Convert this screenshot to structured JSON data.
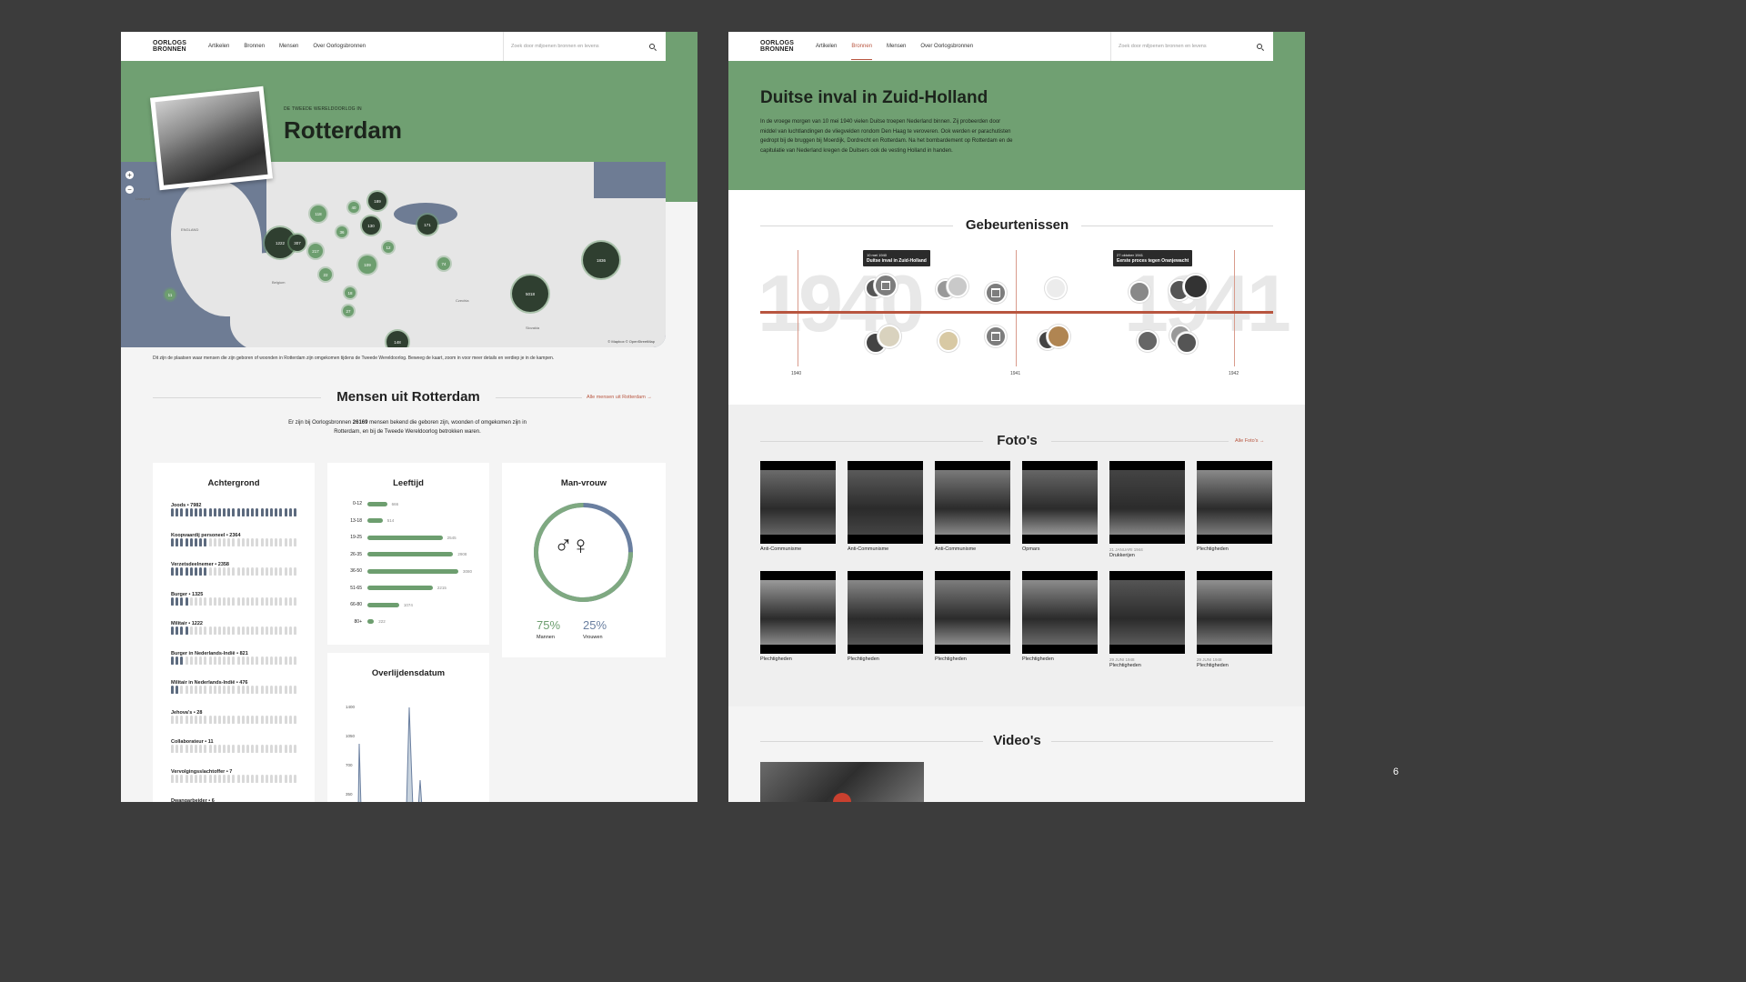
{
  "page_number": "6",
  "left": {
    "logo": [
      "OORLOGS",
      "BRONNEN"
    ],
    "nav": [
      "Artikelen",
      "Bronnen",
      "Mensen",
      "Over Oorlogsbronnen"
    ],
    "search_placeholder": "Zoek door miljoenen bronnen en levens",
    "hero": {
      "kicker": "DE TWEEDE WERELDOORLOG IN",
      "title": "Rotterdam"
    },
    "map": {
      "labels": [
        "ENGLAND",
        "Belgium",
        "Czechia",
        "Slovakia",
        "Liverpool"
      ],
      "clusters": [
        "1222",
        "307",
        "217",
        "118",
        "189",
        "130",
        "171",
        "1836",
        "5018",
        "109",
        "148",
        "74",
        "22",
        "40",
        "12",
        "18",
        "36",
        "27",
        "11"
      ],
      "attribution": "© Mapbox © OpenStreetMap",
      "caption": "Dit zijn de plaatsen waar mensen die zijn geboren of woonden in Rotterdam zijn omgekomen tijdens de Tweede Wereldoorlog. Beweeg de kaart, zoom in voor meer details en verdiep je in de kampen."
    },
    "people_section": {
      "title": "Mensen uit Rotterdam",
      "link": "Alle mensen uit Rotterdam",
      "intro_pre": "Er zijn bij Oorlogsbronnen ",
      "intro_count": "26169",
      "intro_post": " mensen bekend die geboren zijn, woonden of omgekomen zijn in Rotterdam, en bij de Tweede Wereldoorlog betrokken waren."
    },
    "background": {
      "title": "Achtergrond",
      "rows": [
        {
          "label": "Joods • 7982",
          "filled": 27
        },
        {
          "label": "Koopvaardij personeel • 2364",
          "filled": 8
        },
        {
          "label": "Verzetsdeelnemer • 2358",
          "filled": 8
        },
        {
          "label": "Burger • 1325",
          "filled": 4
        },
        {
          "label": "Militair • 1222",
          "filled": 4
        },
        {
          "label": "Burger in Nederlands-Indië • 821",
          "filled": 3
        },
        {
          "label": "Militair in Nederlands-Indië • 476",
          "filled": 2
        },
        {
          "label": "Jehova's • 28",
          "filled": 0
        },
        {
          "label": "Collaborateur • 11",
          "filled": 0
        },
        {
          "label": "Vervolgingsslachtoffer • 7",
          "filled": 0
        },
        {
          "label": "Dwangarbeider • 6",
          "filled": 0
        }
      ]
    },
    "age": {
      "title": "Leeftijd",
      "rows": [
        {
          "range": "0-12",
          "value": 666
        },
        {
          "range": "13-18",
          "value": 514
        },
        {
          "range": "19-25",
          "value": 2545
        },
        {
          "range": "26-35",
          "value": 2908
        },
        {
          "range": "36-50",
          "value": 3080
        },
        {
          "range": "51-65",
          "value": 2215
        },
        {
          "range": "66-80",
          "value": 1074
        },
        {
          "range": "80+",
          "value": 222
        }
      ]
    },
    "gender": {
      "title": "Man-vrouw",
      "symbol": "♂♀",
      "men_pct": "75%",
      "women_pct": "25%",
      "men_label": "Mannen",
      "women_label": "Vrouwen",
      "men_fraction": 0.75
    },
    "death_date": {
      "title": "Overlijdensdatum",
      "ticks": [
        "1400",
        "1050",
        "700",
        "350"
      ]
    }
  },
  "right": {
    "logo": [
      "OORLOGS",
      "BRONNEN"
    ],
    "nav": [
      "Artikelen",
      "Bronnen",
      "Mensen",
      "Over Oorlogsbronnen"
    ],
    "nav_active": 1,
    "search_placeholder": "Zoek door miljoenen bronnen en levens",
    "hero": {
      "title": "Duitse inval in Zuid-Holland",
      "intro": "In de vroege morgen van 10 mei 1940 vielen Duitse troepen Nederland binnen. Zij probeerden door middel van luchtlandingen de vliegvelden rondom Den Haag te veroveren. Ook werden er parachutisten gedropt bij de bruggen bij Moerdijk, Dordrecht en Rotterdam. Na het bombardement op Rotterdam en de capitulatie van Nederland kregen de Duitsers ook de vesting Holland in handen."
    },
    "events": {
      "title": "Gebeurtenissen",
      "big_years": [
        "1940",
        "1941"
      ],
      "tick_labels": [
        "1940",
        "1941",
        "1942"
      ],
      "tooltip1": {
        "date": "10 mei 1940",
        "title": "Duitse inval in Zuid-Holland"
      },
      "tooltip2": {
        "date": "27 oktober 1941",
        "title": "Eerste proces tegen Oranjewacht"
      }
    },
    "photos": {
      "title": "Foto's",
      "link": "Alle Foto's",
      "items": [
        {
          "date": "",
          "caption": "Anti-Communisme"
        },
        {
          "date": "",
          "caption": "Anti-Communisme"
        },
        {
          "date": "",
          "caption": "Anti-Communisme"
        },
        {
          "date": "",
          "caption": "Opmars"
        },
        {
          "date": "21 JANUARI 1944",
          "caption": "Drukkerijen"
        },
        {
          "date": "",
          "caption": "Plechtigheden"
        },
        {
          "date": "",
          "caption": "Plechtigheden"
        },
        {
          "date": "",
          "caption": "Plechtigheden"
        },
        {
          "date": "",
          "caption": "Plechtigheden"
        },
        {
          "date": "",
          "caption": "Plechtigheden"
        },
        {
          "date": "29 JUNI 1948",
          "caption": "Plechtigheden"
        },
        {
          "date": "29 JUNI 1948",
          "caption": "Plechtigheden"
        }
      ]
    },
    "videos": {
      "title": "Video's"
    }
  }
}
